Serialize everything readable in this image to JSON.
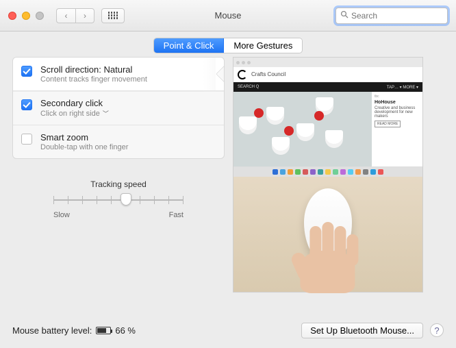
{
  "window": {
    "title": "Mouse"
  },
  "search": {
    "placeholder": "Search"
  },
  "tabs": {
    "a": "Point & Click",
    "b": "More Gestures"
  },
  "options": {
    "scroll": {
      "title": "Scroll direction: Natural",
      "sub": "Content tracks finger movement",
      "checked": true
    },
    "secondary": {
      "title": "Secondary click",
      "sub": "Click on right side",
      "checked": true
    },
    "smartzoom": {
      "title": "Smart zoom",
      "sub": "Double-tap with one finger",
      "checked": false
    }
  },
  "tracking": {
    "label": "Tracking speed",
    "slow": "Slow",
    "fast": "Fast"
  },
  "preview": {
    "sitename": "Crafts Council",
    "nav_left": "SEARCH Q",
    "nav_right": "TAP… ▾   MORE ▾",
    "side_tag": "tbc",
    "side_title": "HoHouse",
    "side_desc": "Creative and business development for new makers",
    "side_btn": "READ MORE"
  },
  "footer": {
    "battery_label": "Mouse battery level:",
    "battery_pct": "66 %",
    "bt_button": "Set Up Bluetooth Mouse...",
    "help": "?"
  }
}
